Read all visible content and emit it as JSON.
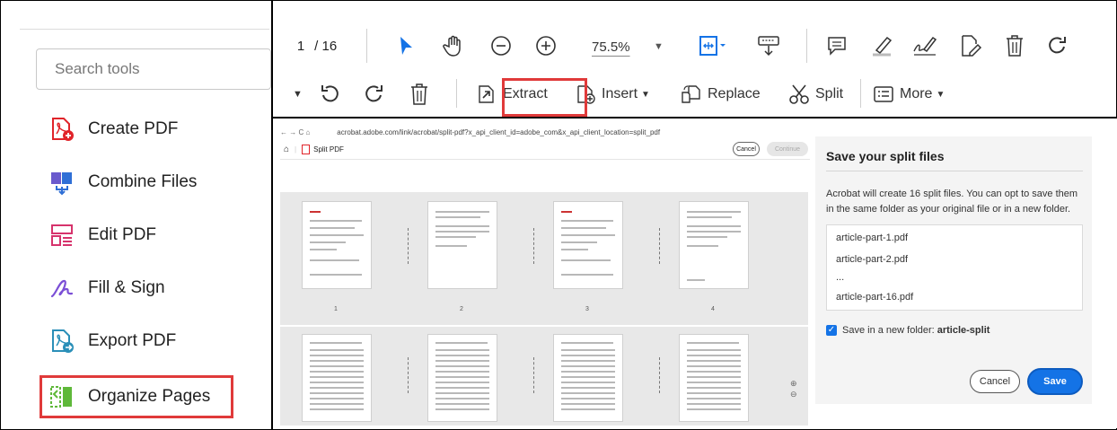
{
  "colors": {
    "accent": "#1473e6",
    "highlight": "#e03a3a",
    "acrobat_red": "#e0242a"
  },
  "left_panel": {
    "search_placeholder": "Search tools",
    "tools": [
      {
        "label": "Create PDF",
        "icon": "create-pdf-icon"
      },
      {
        "label": "Combine Files",
        "icon": "combine-files-icon"
      },
      {
        "label": "Edit PDF",
        "icon": "edit-pdf-icon"
      },
      {
        "label": "Fill & Sign",
        "icon": "fill-sign-icon"
      },
      {
        "label": "Export PDF",
        "icon": "export-pdf-icon"
      },
      {
        "label": "Organize Pages",
        "icon": "organize-pages-icon"
      }
    ]
  },
  "toolbar": {
    "page_current": "1",
    "page_total": "/ 16",
    "zoom": "75.5%",
    "icons": [
      "select-arrow-icon",
      "hand-icon",
      "zoom-out-icon",
      "zoom-in-icon",
      "fit-page-icon",
      "scroll-mode-icon",
      "comment-icon",
      "highlight-icon",
      "sign-icon",
      "edit-icon",
      "delete-icon",
      "redo-icon"
    ]
  },
  "organize_toolbar": {
    "extract": "Extract",
    "insert": "Insert",
    "replace": "Replace",
    "split": "Split",
    "more": "More"
  },
  "embedded": {
    "url": "acrobat.adobe.com/link/acrobat/split-pdf?x_api_client_id=adobe_com&x_api_client_location=split_pdf",
    "app_title": "Split PDF",
    "cancel": "Cancel",
    "continue": "Continue",
    "page_numbers": [
      "1",
      "2",
      "3",
      "4"
    ]
  },
  "dialog": {
    "title": "Save your split files",
    "description": "Acrobat will create 16 split files. You can opt to save them in the same folder as your original file or in a new folder.",
    "files": [
      "article-part-1.pdf",
      "article-part-2.pdf",
      "...",
      "article-part-16.pdf"
    ],
    "checkbox_label": "Save in a new folder:",
    "folder_name": "article-split",
    "cancel": "Cancel",
    "save": "Save"
  }
}
